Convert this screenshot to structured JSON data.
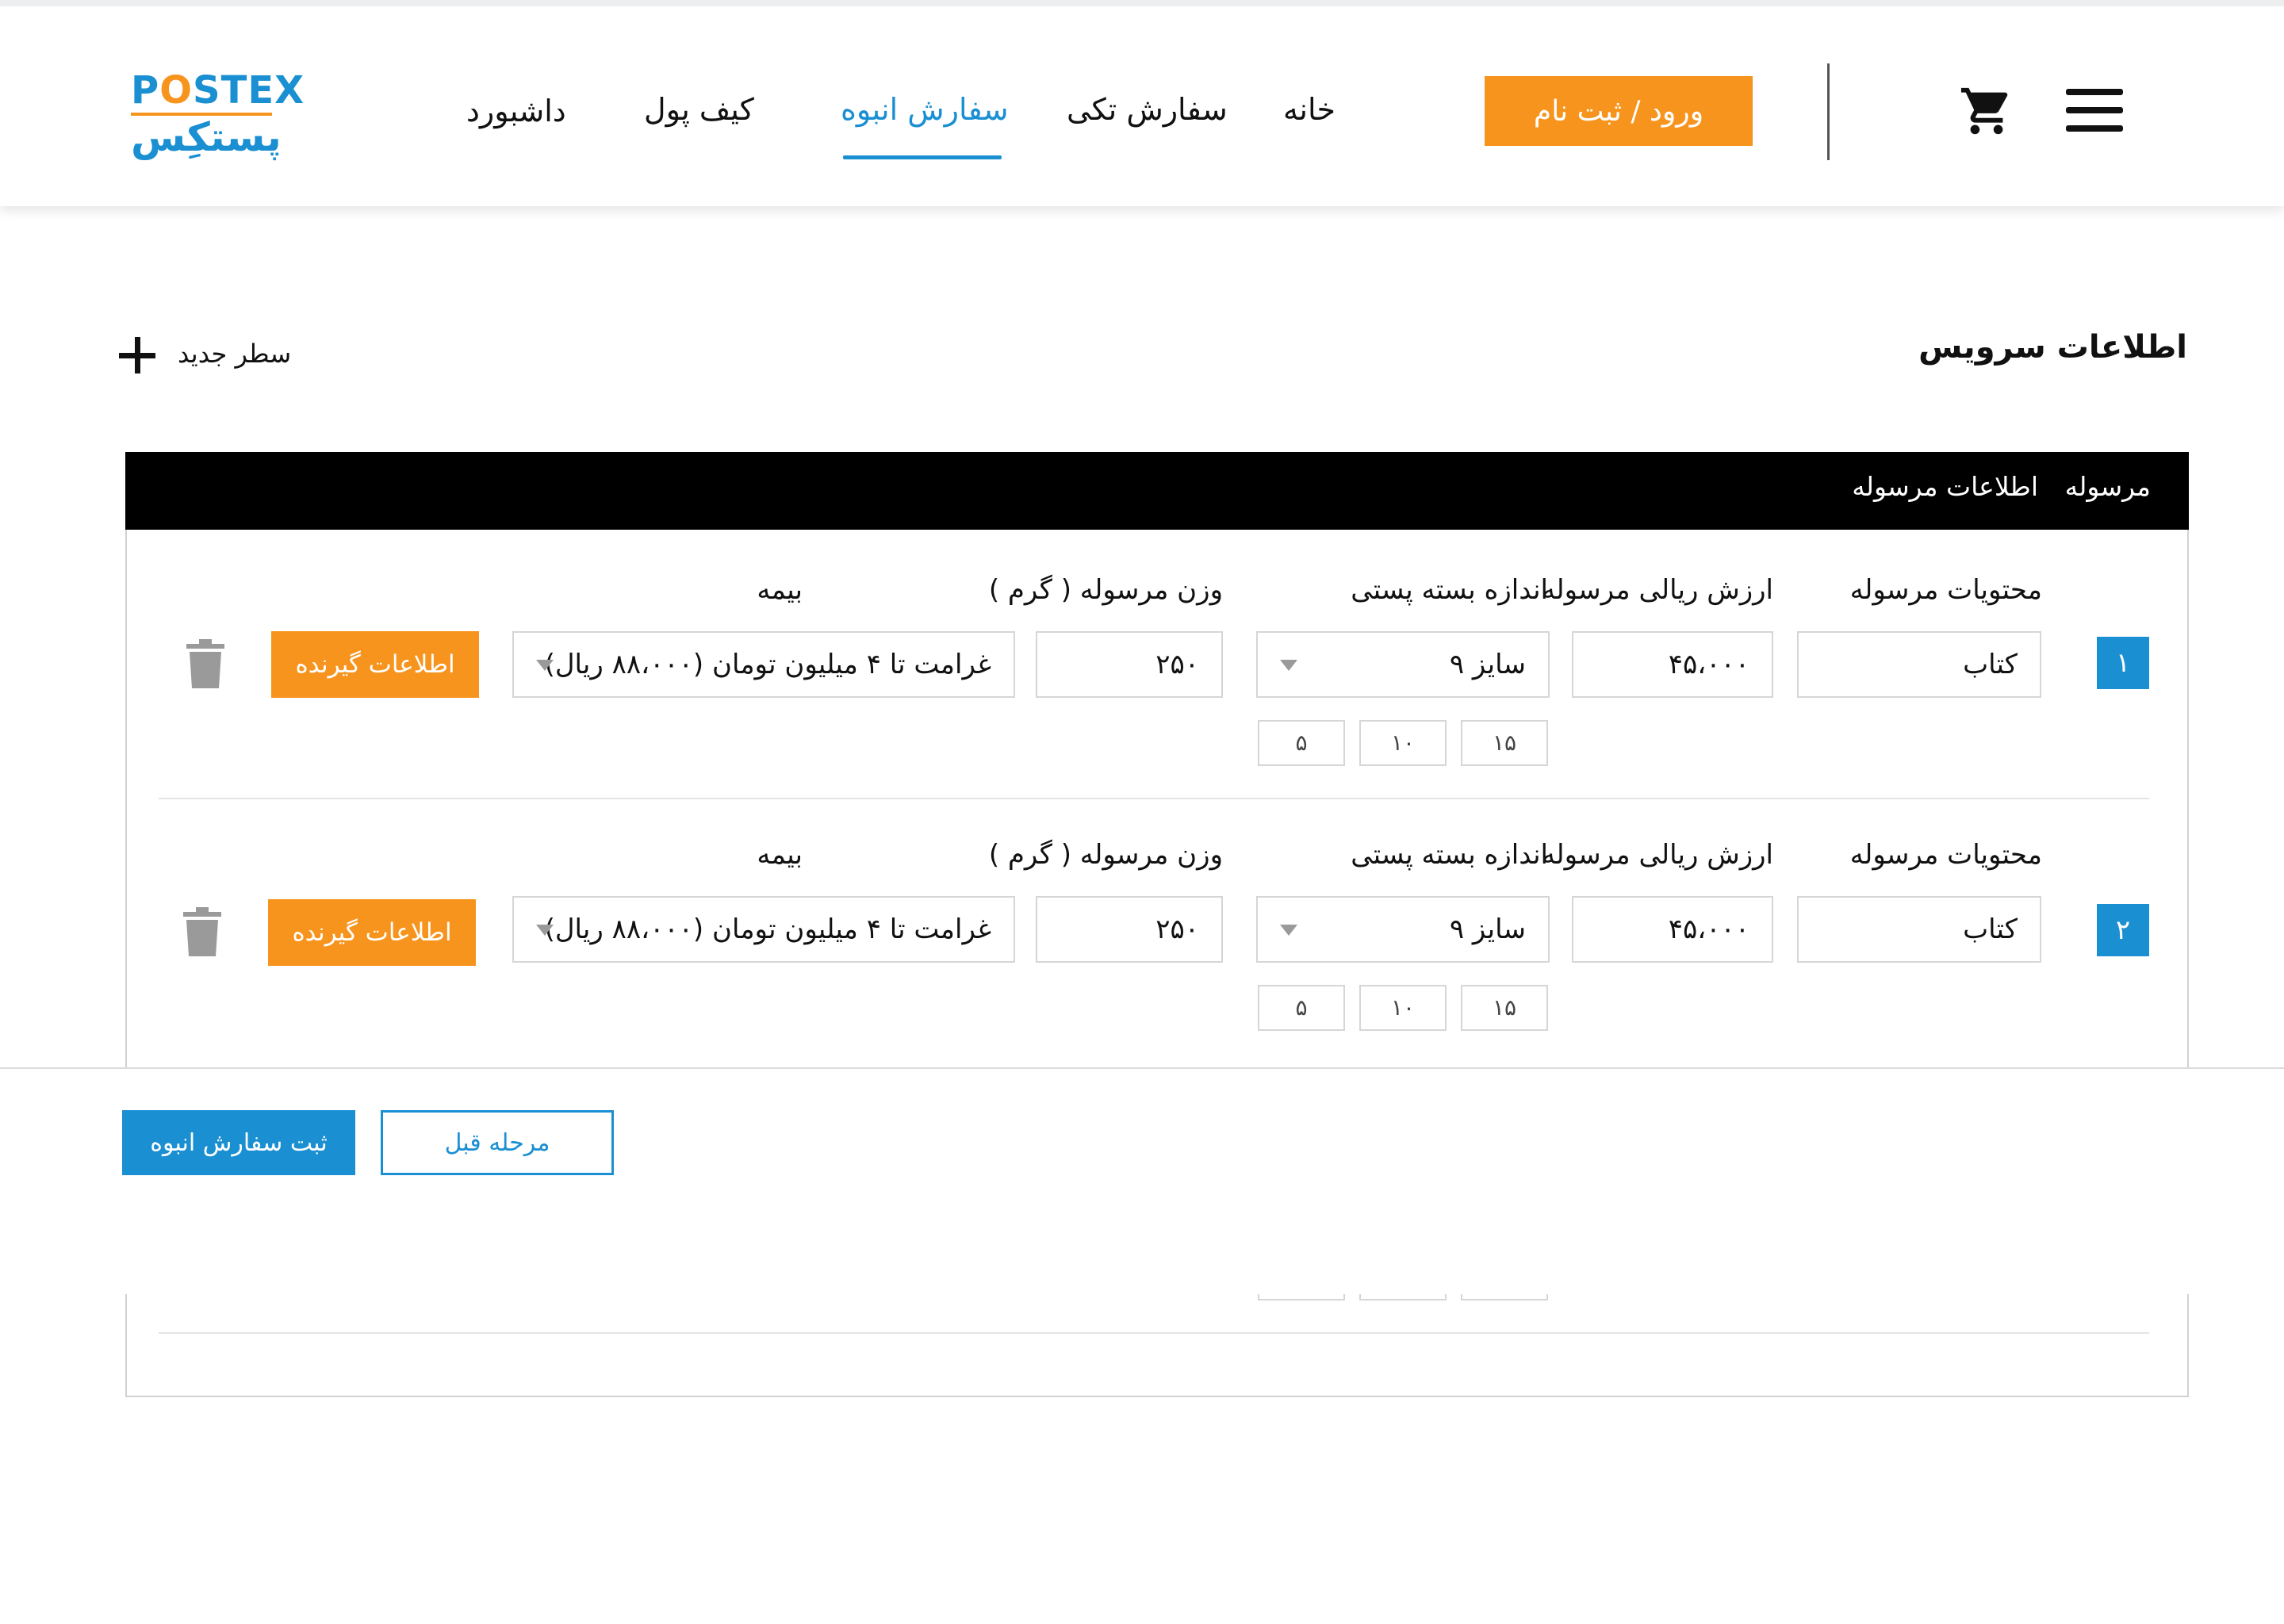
{
  "header": {
    "logo": {
      "latin_pre": "P",
      "latin_o": "O",
      "latin_post": "STEX",
      "persian": "پستکِس"
    },
    "nav": {
      "home": "خانه",
      "single_order": "سفارش تکی",
      "bulk_order": "سفارش انبوه",
      "wallet": "کیف پول",
      "dashboard": "داشبورد"
    },
    "login_label": "ورود / ثبت نام"
  },
  "section": {
    "title": "اطلاعات سرویس",
    "new_row_label": "سطر جدید"
  },
  "table": {
    "headers": {
      "parcel": "مرسوله",
      "parcel_info": "اطلاعات مرسوله"
    },
    "labels": {
      "contents": "محتویات مرسوله",
      "value": "ارزش ریالی مرسوله",
      "size": "اندازه بسته پستی",
      "weight": "وزن مرسوله ( گرم )",
      "insurance": "بیمه"
    },
    "rows": [
      {
        "num": "۱",
        "contents": "کتاب",
        "value": "۴۵،۰۰۰",
        "size": "سایز ۹",
        "weight": "۲۵۰",
        "insurance": "غرامت تا ۴ میلیون تومان (۸۸،۰۰۰ ریال)",
        "dims": [
          "۱۵",
          "۱۰",
          "۵"
        ],
        "receiver_label": "اطلاعات گیرنده"
      },
      {
        "num": "۲",
        "contents": "کتاب",
        "value": "۴۵،۰۰۰",
        "size": "سایز ۹",
        "weight": "۲۵۰",
        "insurance": "غرامت تا ۴ میلیون تومان (۸۸،۰۰۰ ریال)",
        "dims": [
          "۱۵",
          "۱۰",
          "۵"
        ],
        "receiver_label": "اطلاعات گیرنده"
      }
    ]
  },
  "footer": {
    "submit_label": "ثبت سفارش انبوه",
    "prev_label": "مرحله قبل"
  },
  "colors": {
    "brand_blue": "#1a8fd2",
    "brand_orange": "#f7941d"
  },
  "icons": {
    "cart": "cart-icon",
    "menu": "menu-icon",
    "plus": "plus-icon",
    "trash": "trash-icon",
    "dropdown": "chevron-down-icon"
  }
}
